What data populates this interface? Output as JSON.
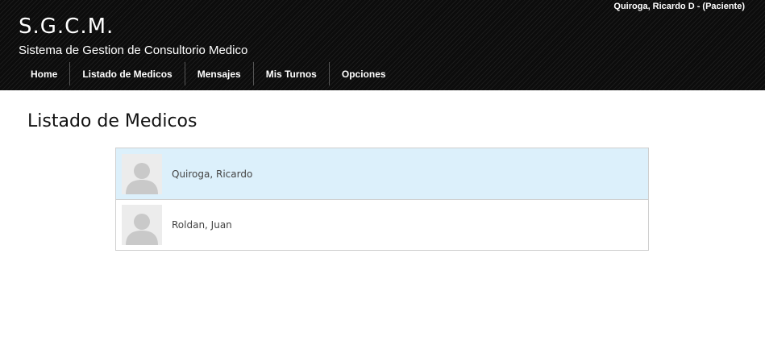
{
  "header": {
    "user_info": "Quiroga, Ricardo D - (Paciente)",
    "brand_title": "S.G.C.M.",
    "brand_subtitle": "Sistema de Gestion de Consultorio Medico"
  },
  "nav": {
    "items": [
      {
        "label": "Home"
      },
      {
        "label": "Listado de Medicos"
      },
      {
        "label": "Mensajes"
      },
      {
        "label": "Mis Turnos"
      },
      {
        "label": "Opciones"
      }
    ]
  },
  "main": {
    "title": "Listado de Medicos",
    "doctors": [
      {
        "name": "Quiroga, Ricardo",
        "avatar_icon": "user-placeholder-icon",
        "selected": true
      },
      {
        "name": "Roldan, Juan",
        "avatar_icon": "user-placeholder-icon",
        "selected": false
      }
    ]
  },
  "colors": {
    "header_bg": "#101010",
    "selected_row": "#dcf0fb",
    "border": "#cfcfcf"
  }
}
